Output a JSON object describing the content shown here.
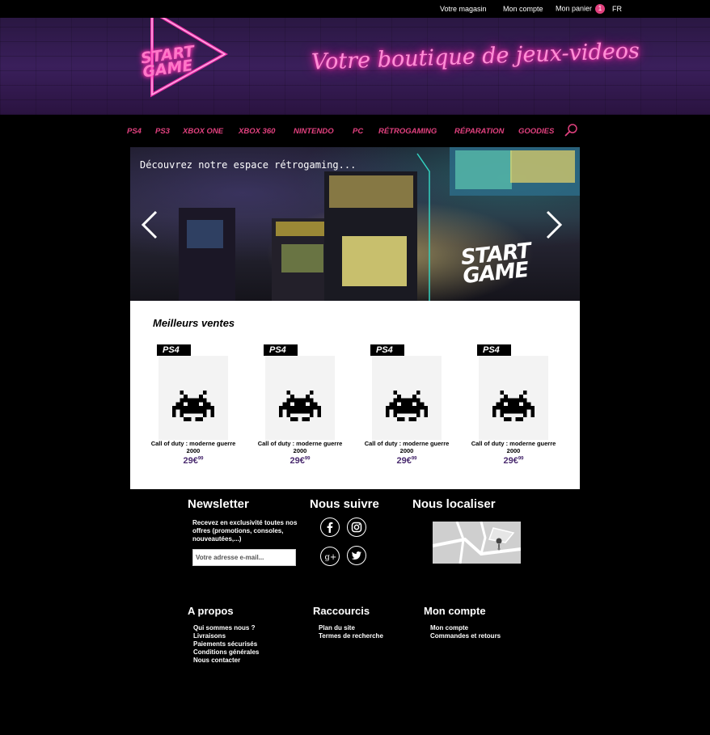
{
  "topbar": {
    "store": "Votre magasin",
    "account": "Mon compte",
    "cart": "Mon panier",
    "cart_count": "1",
    "lang": "FR"
  },
  "header": {
    "logo_line1": "START",
    "logo_line2": "GAME",
    "tagline": "Votre boutique de jeux-videos"
  },
  "nav": {
    "items": [
      "PS4",
      "PS3",
      "XBOX ONE",
      "XBOX 360",
      "NINTENDO",
      "PC",
      "RÉTROGAMING",
      "RÉPARATION",
      "GOODIES"
    ],
    "search_icon": "search-icon"
  },
  "banner": {
    "caption": "Découvrez notre espace rétrogaming...",
    "logo_line1": "START",
    "logo_line2": "GAME"
  },
  "bestsellers": {
    "title": "Meilleurs ventes",
    "products": [
      {
        "platform": "PS4",
        "name": "Call of duty : moderne guerre 2000",
        "price_main": "29€",
        "price_cents": "99"
      },
      {
        "platform": "PS4",
        "name": "Call of duty : moderne guerre 2000",
        "price_main": "29€",
        "price_cents": "99"
      },
      {
        "platform": "PS4",
        "name": "Call of duty : moderne guerre 2000",
        "price_main": "29€",
        "price_cents": "99"
      },
      {
        "platform": "PS4",
        "name": "Call of duty : moderne guerre 2000",
        "price_main": "29€",
        "price_cents": "99"
      }
    ]
  },
  "footer": {
    "newsletter": {
      "title": "Newsletter",
      "text": "Recevez en exclusivité toutes nos offres (promotions, consoles, nouveautées,...)",
      "placeholder": "Votre adresse e-mail..."
    },
    "follow": {
      "title": "Nous suivre",
      "icons": [
        "facebook-icon",
        "instagram-icon",
        "google-plus-icon",
        "twitter-icon"
      ]
    },
    "locate": {
      "title": "Nous localiser"
    },
    "about": {
      "title": "A propos",
      "links": [
        "Qui sommes nous ?",
        "Livraisons",
        "Paiements sécurisés",
        "Conditions générales",
        "Nous contacter"
      ]
    },
    "shortcuts": {
      "title": "Raccourcis",
      "links": [
        "Plan du site",
        "Termes de recherche"
      ]
    },
    "account": {
      "title": "Mon compte",
      "links": [
        "Mon compte",
        "Commandes et retours"
      ]
    }
  },
  "colors": {
    "accent_pink": "#e2417f",
    "price_purple": "#4a2b6f",
    "neon_pink": "#ff2fb0"
  }
}
